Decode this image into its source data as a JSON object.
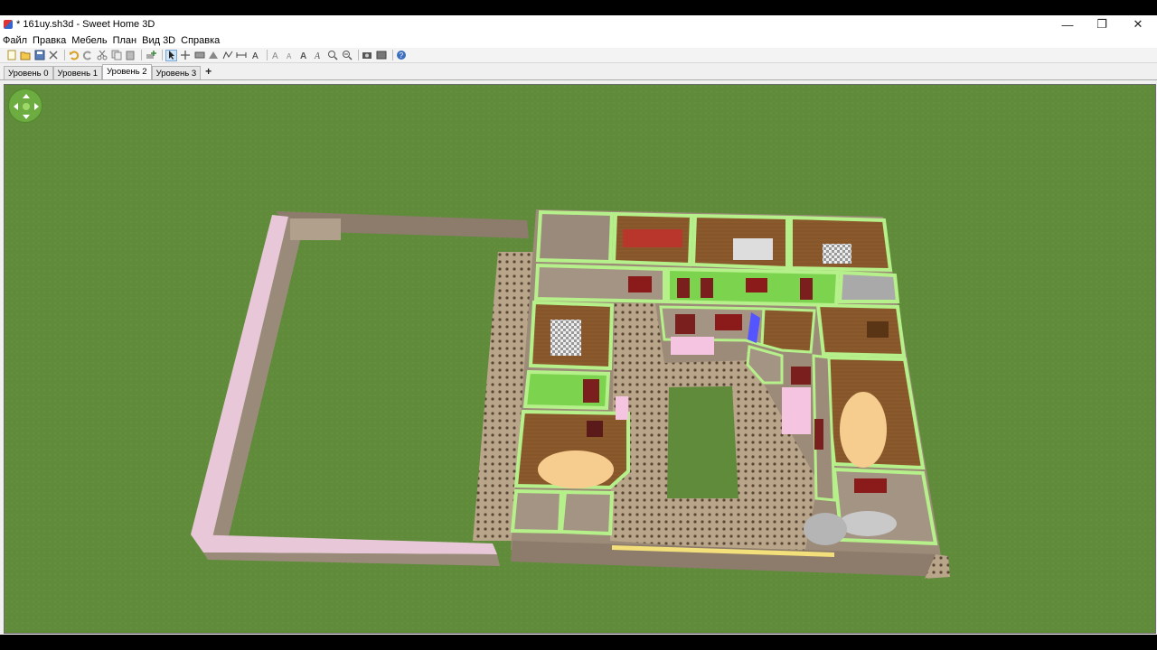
{
  "window": {
    "title": "* 161uy.sh3d - Sweet Home 3D",
    "minimize_glyph": "—",
    "maximize_glyph": "❐",
    "close_glyph": "✕"
  },
  "menu": {
    "items": [
      "Файл",
      "Правка",
      "Мебель",
      "План",
      "Вид 3D",
      "Справка"
    ]
  },
  "toolbar": {
    "icons": [
      "new-home-icon",
      "open-icon",
      "save-icon",
      "cut-tool-icon",
      "undo-icon",
      "redo-icon",
      "cut-icon",
      "copy-icon",
      "paste-icon",
      "add-furniture-icon",
      "select-icon",
      "pan-icon",
      "create-walls-icon",
      "create-rooms-icon",
      "create-polylines-icon",
      "create-dimensions-icon",
      "add-text-icon",
      "increase-text-size-icon",
      "decrease-text-size-icon",
      "bold-text-icon",
      "italic-text-icon",
      "zoom-in-icon",
      "zoom-out-icon",
      "create-photo-icon",
      "create-video-icon",
      "help-icon"
    ]
  },
  "levels": {
    "tabs": [
      "Уровень 0",
      "Уровень 1",
      "Уровень 2",
      "Уровень 3"
    ],
    "active_index": 2,
    "add_label": "+"
  },
  "view3d": {
    "ground_color": "#5f8b3a",
    "wall_accent": "#b6f08a"
  }
}
